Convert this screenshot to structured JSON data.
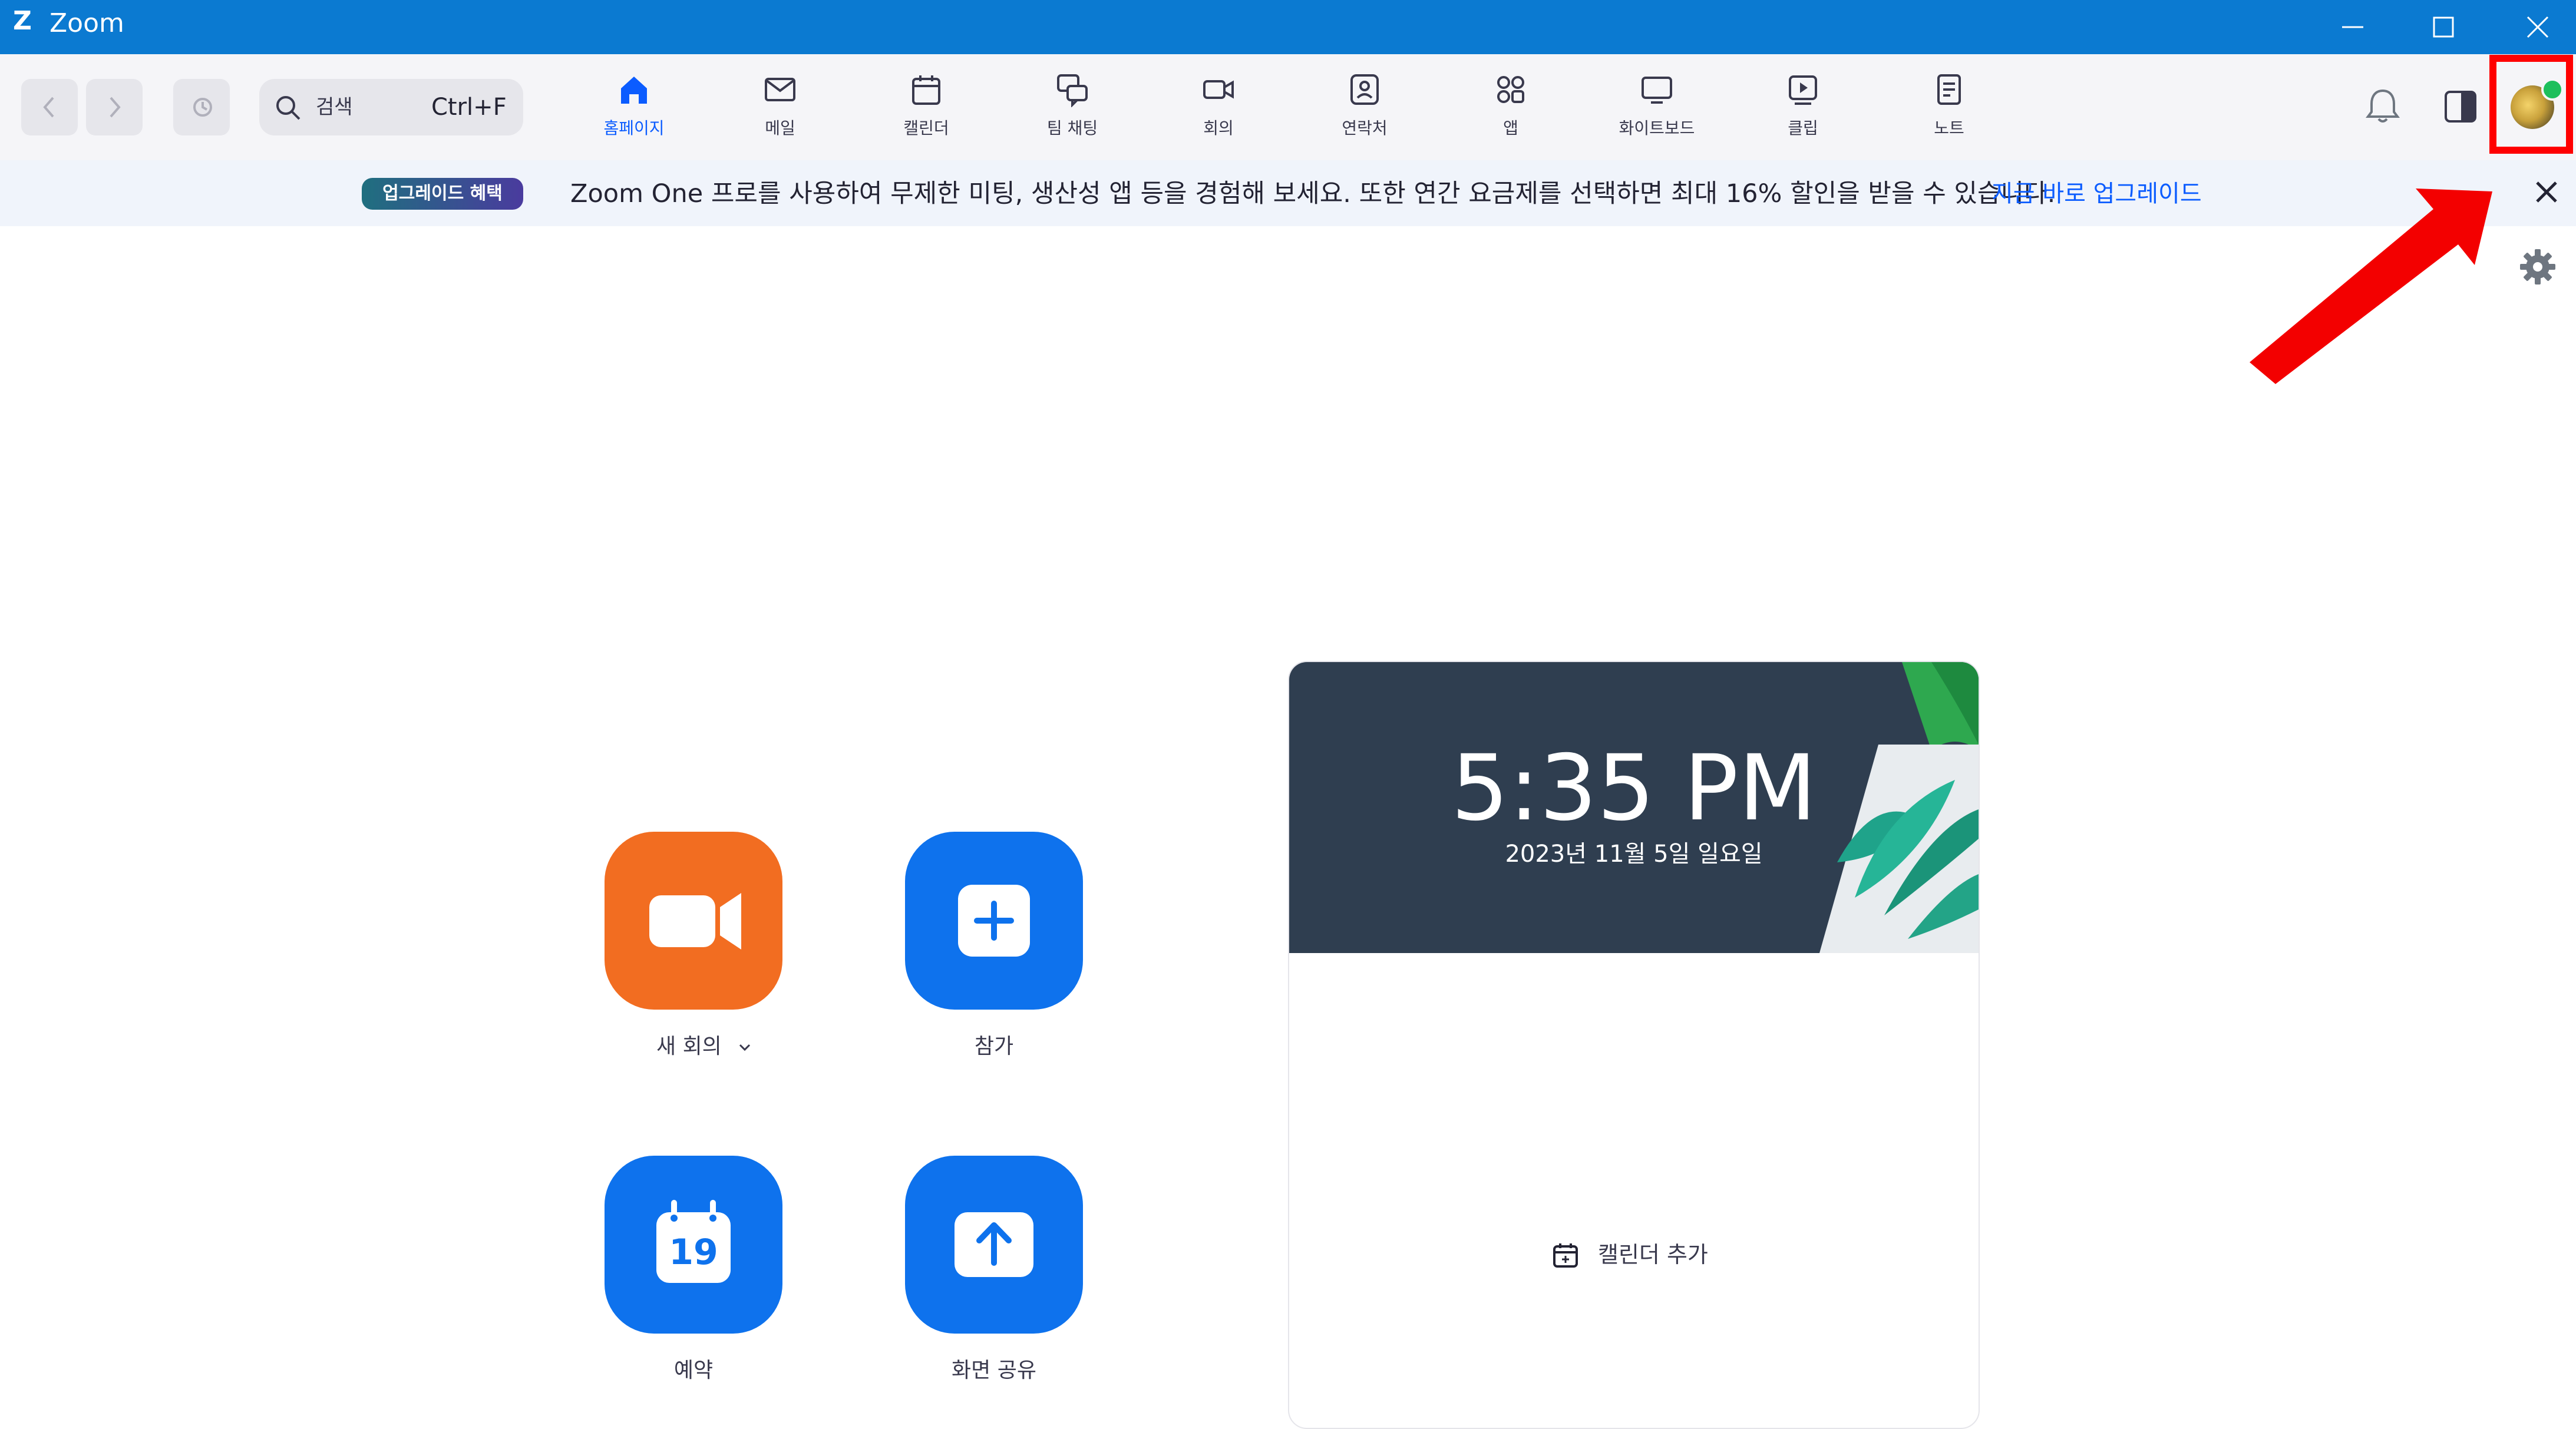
{
  "window": {
    "app_title": "Zoom",
    "logo_letter": "Z",
    "controls": [
      "minimize",
      "maximize",
      "close"
    ]
  },
  "toolbar": {
    "search": {
      "placeholder": "검색",
      "shortcut": "Ctrl+F"
    },
    "tabs": [
      {
        "label": "홈페이지",
        "icon": "home-icon",
        "active": true
      },
      {
        "label": "메일",
        "icon": "mail-icon",
        "active": false
      },
      {
        "label": "캘린더",
        "icon": "calendar-icon",
        "active": false
      },
      {
        "label": "팀 채팅",
        "icon": "chat-icon",
        "active": false
      },
      {
        "label": "회의",
        "icon": "video-icon",
        "active": false
      },
      {
        "label": "연락처",
        "icon": "contacts-icon",
        "active": false
      },
      {
        "label": "앱",
        "icon": "apps-icon",
        "active": false
      },
      {
        "label": "화이트보드",
        "icon": "whiteboard-icon",
        "active": false
      },
      {
        "label": "클립",
        "icon": "clips-icon",
        "active": false
      },
      {
        "label": "노트",
        "icon": "notes-icon",
        "active": false
      }
    ],
    "right_icons": [
      "bell-icon",
      "side-panel-icon",
      "avatar"
    ]
  },
  "banner": {
    "badge": "업그레이드 혜택",
    "message": "Zoom One 프로를 사용하여 무제한 미팅, 생산성 앱 등을 경험해 보세요. 또한 연간 요금제를 선택하면 최대 16% 할인을 받을 수 있습니다.",
    "link": "지금 바로 업그레이드"
  },
  "actions": {
    "new_meeting": "새 회의",
    "join": "참가",
    "schedule": "예약",
    "schedule_day": "19",
    "share_screen": "화면 공유"
  },
  "clock_card": {
    "time": "5:35 PM",
    "date": "2023년 11월 5일 일요일",
    "add_calendar": "캘린더 추가"
  },
  "colors": {
    "title_bar": "#0b7ad1",
    "accent": "#0b5cff",
    "orange": "#f26d21",
    "action_blue": "#0e72ed",
    "highlight": "#ff0000"
  }
}
